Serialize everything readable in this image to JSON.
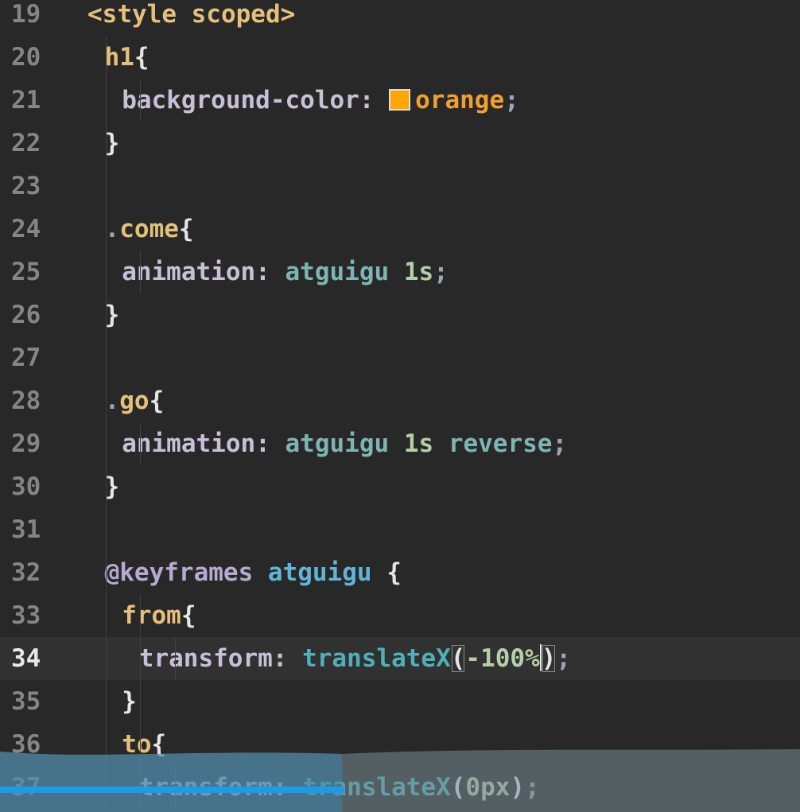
{
  "editor": {
    "current_line": 34,
    "swatch_color": "#ffa500",
    "lines": [
      {
        "num": "19",
        "tokens": [
          {
            "t": "<style scoped>",
            "c": "tk-tag"
          }
        ]
      },
      {
        "num": "20",
        "tokens": [
          {
            "t": "h1",
            "c": "tk-sel"
          },
          {
            "t": "{",
            "c": "tk-punc"
          }
        ]
      },
      {
        "num": "21",
        "tokens": [
          {
            "t": "background-color: ",
            "c": "tk-prop"
          },
          {
            "swatch": true
          },
          {
            "t": "orange",
            "c": "tk-orange"
          },
          {
            "t": ";",
            "c": "tk-semi"
          }
        ]
      },
      {
        "num": "22",
        "tokens": [
          {
            "t": "}",
            "c": "tk-punc"
          }
        ]
      },
      {
        "num": "23",
        "tokens": []
      },
      {
        "num": "24",
        "tokens": [
          {
            "t": ".",
            "c": "tk-dot"
          },
          {
            "t": "come",
            "c": "tk-class"
          },
          {
            "t": "{",
            "c": "tk-punc"
          }
        ]
      },
      {
        "num": "25",
        "tokens": [
          {
            "t": "animation: ",
            "c": "tk-prop"
          },
          {
            "t": "atguigu",
            "c": "tk-val"
          },
          {
            "t": " 1s",
            "c": "tk-num"
          },
          {
            "t": ";",
            "c": "tk-semi"
          }
        ]
      },
      {
        "num": "26",
        "tokens": [
          {
            "t": "}",
            "c": "tk-punc"
          }
        ]
      },
      {
        "num": "27",
        "tokens": []
      },
      {
        "num": "28",
        "tokens": [
          {
            "t": ".",
            "c": "tk-dot"
          },
          {
            "t": "go",
            "c": "tk-class"
          },
          {
            "t": "{",
            "c": "tk-punc"
          }
        ]
      },
      {
        "num": "29",
        "tokens": [
          {
            "t": "animation: ",
            "c": "tk-prop"
          },
          {
            "t": "atguigu",
            "c": "tk-val"
          },
          {
            "t": " 1s",
            "c": "tk-num"
          },
          {
            "t": " reverse",
            "c": "tk-val"
          },
          {
            "t": ";",
            "c": "tk-semi"
          }
        ]
      },
      {
        "num": "30",
        "tokens": [
          {
            "t": "}",
            "c": "tk-punc"
          }
        ]
      },
      {
        "num": "31",
        "tokens": []
      },
      {
        "num": "32",
        "tokens": [
          {
            "t": "@keyframes ",
            "c": "tk-kw"
          },
          {
            "t": "atguigu",
            "c": "tk-anim"
          },
          {
            "t": " {",
            "c": "tk-punc"
          }
        ]
      },
      {
        "num": "33",
        "tokens": [
          {
            "t": "from",
            "c": "tk-sel"
          },
          {
            "t": "{",
            "c": "tk-punc"
          }
        ]
      },
      {
        "num": "34",
        "tokens": [
          {
            "t": "transform: ",
            "c": "tk-prop"
          },
          {
            "t": "translateX",
            "c": "tk-fn"
          },
          {
            "t": "(",
            "c": "tk-punc",
            "box": true
          },
          {
            "t": "-100%",
            "c": "tk-num"
          },
          {
            "cursor": true
          },
          {
            "t": ")",
            "c": "tk-punc",
            "box": true
          },
          {
            "t": ";",
            "c": "tk-semi"
          }
        ]
      },
      {
        "num": "35",
        "tokens": [
          {
            "t": "}",
            "c": "tk-punc"
          }
        ]
      },
      {
        "num": "36",
        "tokens": [
          {
            "t": "to",
            "c": "tk-sel"
          },
          {
            "t": "{",
            "c": "tk-punc"
          }
        ]
      },
      {
        "num": "37",
        "tokens": [
          {
            "t": "transform: ",
            "c": "tk-prop"
          },
          {
            "t": "translateX",
            "c": "tk-fn"
          },
          {
            "t": "(",
            "c": "tk-punc"
          },
          {
            "t": "0px",
            "c": "tk-num"
          },
          {
            "t": ")",
            "c": "tk-punc"
          },
          {
            "t": ";",
            "c": "tk-semi"
          }
        ]
      }
    ]
  },
  "video": {
    "progress": 0.43
  }
}
